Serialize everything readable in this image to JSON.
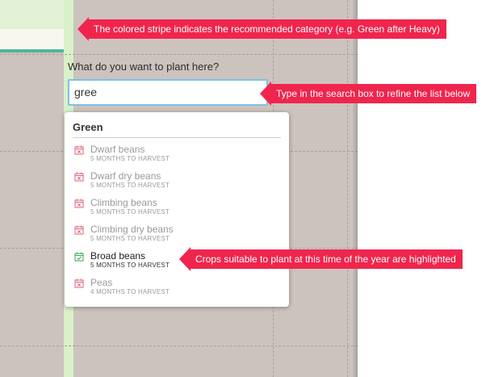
{
  "planting": {
    "prompt": "What do you want to plant here?",
    "search_value": "gree"
  },
  "dropdown": {
    "group_title": "Green",
    "items": [
      {
        "name": "Dwarf beans",
        "sub": "5 MONTHS TO HARVEST",
        "highlighted": false,
        "icon": "calendar-x-icon"
      },
      {
        "name": "Dwarf dry beans",
        "sub": "5 MONTHS TO HARVEST",
        "highlighted": false,
        "icon": "calendar-x-icon"
      },
      {
        "name": "Climbing beans",
        "sub": "5 MONTHS TO HARVEST",
        "highlighted": false,
        "icon": "calendar-x-icon"
      },
      {
        "name": "Climbing dry beans",
        "sub": "5 MONTHS TO HARVEST",
        "highlighted": false,
        "icon": "calendar-x-icon"
      },
      {
        "name": "Broad beans",
        "sub": "5 MONTHS TO HARVEST",
        "highlighted": true,
        "icon": "calendar-check-icon"
      },
      {
        "name": "Peas",
        "sub": "4 MONTHS TO HARVEST",
        "highlighted": false,
        "icon": "calendar-x-icon"
      }
    ]
  },
  "annotations": {
    "stripe_note": "The colored stripe indicates the recommended category (e.g. Green after Heavy)",
    "search_note": "Type in the search box to refine the list below",
    "highlight_note": "Crops suitable to plant at this time of the year are highlighted"
  },
  "colors": {
    "callout": "#f0254d",
    "stripe": "#d9f0c8",
    "garden": "#cdc3be",
    "search_focus": "#7fc0e6",
    "unsuitable_icon": "#e0607a",
    "suitable_icon": "#3aa655"
  }
}
